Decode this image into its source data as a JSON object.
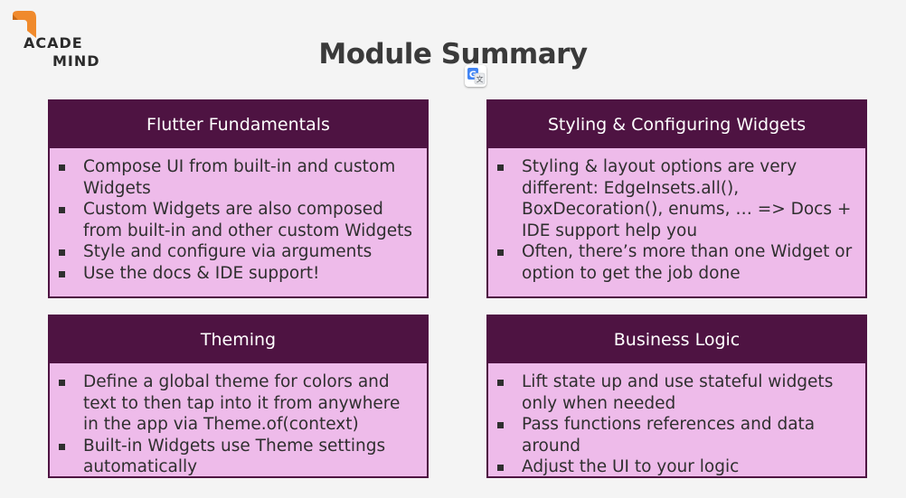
{
  "logo": {
    "line1": "ACADE",
    "line2": "MIND"
  },
  "title": "Module Summary",
  "colors": {
    "header_bg": "#4e1342",
    "card_bg": "#eebbea",
    "logo_orange": "#f08a2c"
  },
  "icons": {
    "translate": "google-translate-icon"
  },
  "cards": [
    {
      "heading": "Flutter Fundamentals",
      "items": [
        "Compose UI from built-in and custom Widgets",
        "Custom Widgets are also composed from built-in and other custom Widgets",
        "Style and configure via arguments",
        "Use the docs & IDE support!"
      ]
    },
    {
      "heading": "Styling & Configuring Widgets",
      "items": [
        "Styling & layout options are very different: EdgeInsets.all(), BoxDecoration(), enums, … => Docs + IDE support help you",
        "Often, there’s more than one Widget or option to get the job done"
      ]
    },
    {
      "heading": "Theming",
      "items": [
        "Define a global theme for colors and text to then tap into it from anywhere in the app via Theme.of(context)",
        "Built-in Widgets use Theme settings automatically"
      ]
    },
    {
      "heading": "Business Logic",
      "items": [
        "Lift state up and use stateful widgets only when needed",
        "Pass functions references and data around",
        "Adjust the UI to your logic"
      ]
    }
  ]
}
